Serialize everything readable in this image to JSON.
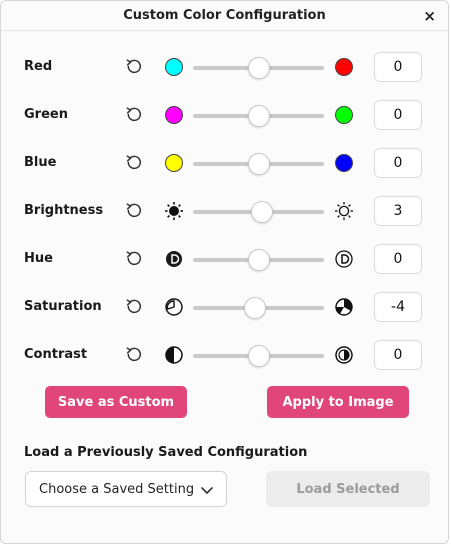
{
  "dialog": {
    "title": "Custom Color Configuration",
    "close_label": "×"
  },
  "rows": [
    {
      "label": "Red",
      "value": "0",
      "slider_fraction": 0.5,
      "left_color": "#00ffff",
      "right_color": "#ff0000",
      "left_icon": "cyan-swatch-icon",
      "right_icon": "red-swatch-icon"
    },
    {
      "label": "Green",
      "value": "0",
      "slider_fraction": 0.5,
      "left_color": "#ff00ff",
      "right_color": "#00ff00",
      "left_icon": "magenta-swatch-icon",
      "right_icon": "green-swatch-icon"
    },
    {
      "label": "Blue",
      "value": "0",
      "slider_fraction": 0.5,
      "left_color": "#ffff00",
      "right_color": "#0000ff",
      "left_icon": "yellow-swatch-icon",
      "right_icon": "blue-swatch-icon"
    },
    {
      "label": "Brightness",
      "value": "3",
      "slider_fraction": 0.53,
      "left_icon": "sun-filled-icon",
      "right_icon": "sun-outline-icon"
    },
    {
      "label": "Hue",
      "value": "0",
      "slider_fraction": 0.5,
      "left_icon": "hue-dark-icon",
      "right_icon": "hue-outline-icon"
    },
    {
      "label": "Saturation",
      "value": "-4",
      "slider_fraction": 0.47,
      "left_icon": "saturation-low-icon",
      "right_icon": "saturation-high-icon"
    },
    {
      "label": "Contrast",
      "value": "0",
      "slider_fraction": 0.5,
      "left_icon": "contrast-low-icon",
      "right_icon": "contrast-high-icon"
    }
  ],
  "buttons": {
    "save_custom": "Save as Custom",
    "apply_image": "Apply to Image"
  },
  "load_section": {
    "title": "Load a Previously Saved Configuration",
    "select_value": "Choose a Saved Setting",
    "load_button": "Load Selected"
  },
  "colors": {
    "accent": "#e0467a"
  }
}
